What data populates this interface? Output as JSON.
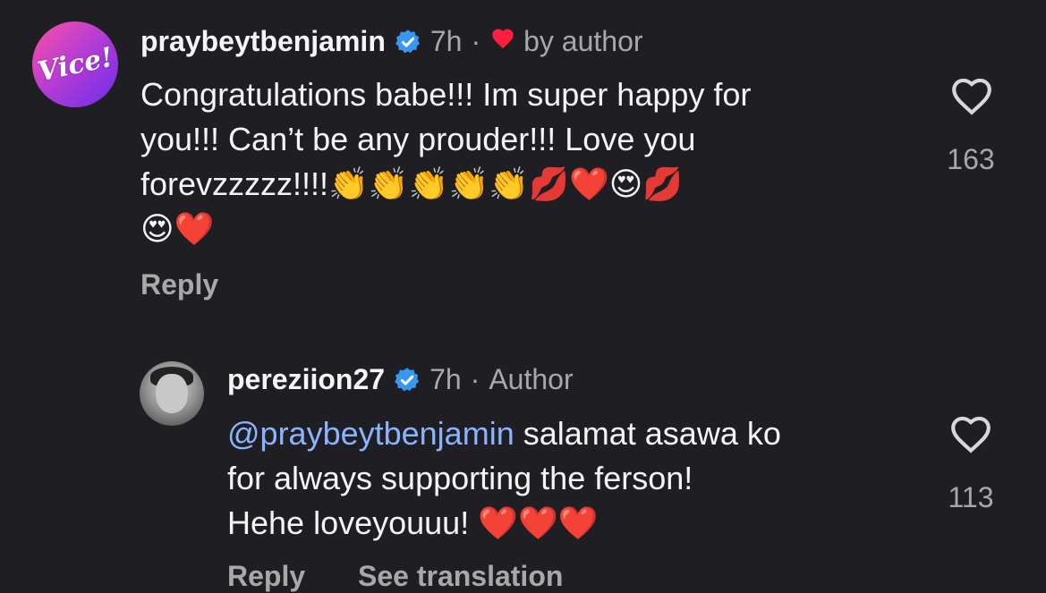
{
  "comment": {
    "username": "praybeytbenjamin",
    "time": "7h",
    "separator": "·",
    "liked_by_author_label": "by author",
    "avatar_logo": "Vice!",
    "lines": [
      "Congratulations babe!!! Im super happy for",
      "you!!! Can’t be any prouder!!! Love you",
      "forevzzzzz!!!!👏👏👏👏👏💋❤️😍💋",
      "😍❤️"
    ],
    "reply_label": "Reply",
    "like_count": "163"
  },
  "reply": {
    "username": "pereziion27",
    "time": "7h",
    "separator": "·",
    "author_label": "Author",
    "mention": "@praybeytbenjamin",
    "line1_rest": " salamat asawa ko",
    "line2": "for always supporting the ferson!",
    "line3": "Hehe loveyouuu! ❤️❤️❤️",
    "reply_label": "Reply",
    "see_translation_label": "See translation",
    "like_count": "113"
  },
  "colors": {
    "background": "#1f1f23",
    "verified_blue": "#3897f0",
    "liked_red": "#ff1e3c",
    "mention_blue": "#8ab4ff",
    "muted": "#a8a8a8"
  }
}
